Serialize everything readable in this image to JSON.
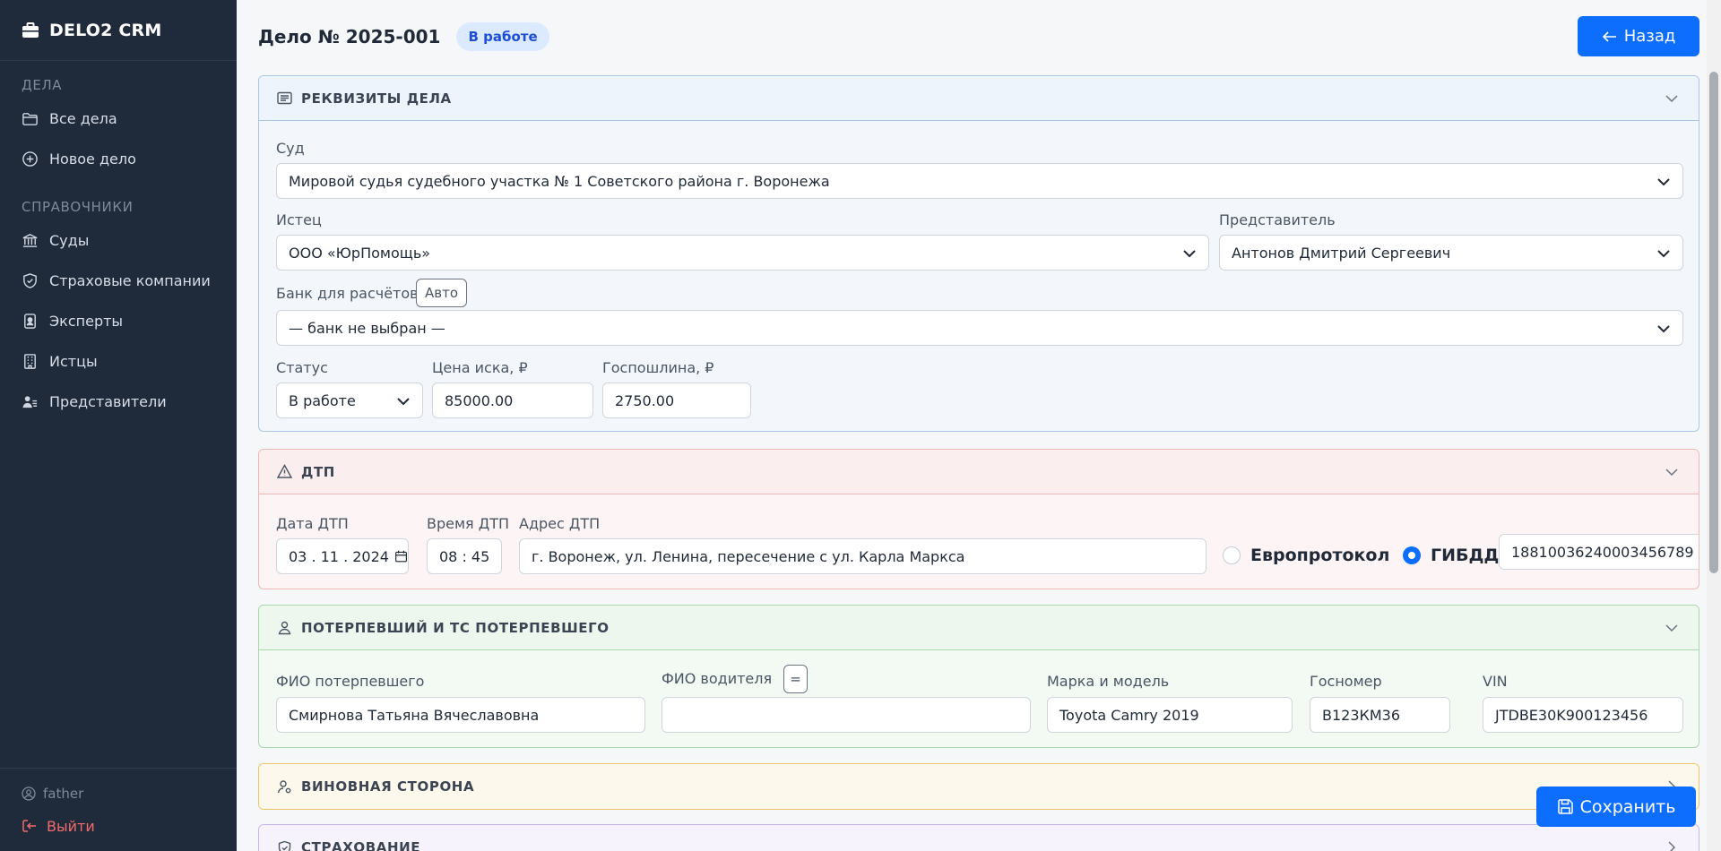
{
  "brand": {
    "name": "DELO2 CRM"
  },
  "sidebar": {
    "sections": [
      {
        "title": "ДЕЛА",
        "items": [
          {
            "label": "Все дела",
            "icon": "folder-icon"
          },
          {
            "label": "Новое дело",
            "icon": "plus-circle-icon"
          }
        ]
      },
      {
        "title": "СПРАВОЧНИКИ",
        "items": [
          {
            "label": "Суды",
            "icon": "bank-icon"
          },
          {
            "label": "Страховые компании",
            "icon": "shield-icon"
          },
          {
            "label": "Эксперты",
            "icon": "badge-icon"
          },
          {
            "label": "Истцы",
            "icon": "building-icon"
          },
          {
            "label": "Представители",
            "icon": "people-icon"
          }
        ]
      }
    ],
    "user": "father",
    "logout": "Выйти"
  },
  "header": {
    "title": "Дело № 2025-001",
    "status_badge": "В работе",
    "back_button": "Назад"
  },
  "rekv": {
    "title": "РЕКВИЗИТЫ ДЕЛА",
    "court_label": "Суд",
    "court_value": "Мировой судья судебного участка № 1 Советского района г. Воронежа",
    "plaintiff_label": "Истец",
    "plaintiff_value": "ООО «ЮрПомощь»",
    "rep_label": "Представитель",
    "rep_value": "Антонов Дмитрий Сергеевич",
    "bank_label": "Банк для расчётов",
    "bank_auto": "Авто",
    "bank_value": "— банк не выбран —",
    "status_label": "Статус",
    "status_value": "В работе",
    "price_label": "Цена иска, ₽",
    "price_value": "85000.00",
    "fee_label": "Госпошлина, ₽",
    "fee_value": "2750.00"
  },
  "dtp": {
    "title": "ДТП",
    "date_label": "Дата ДТП",
    "date_value": "03 . 11 . 2024",
    "time_label": "Время ДТП",
    "time_value": "08 : 45",
    "address_label": "Адрес ДТП",
    "address_value": "г. Воронеж, ул. Ленина, пересечение с ул. Карла Маркса",
    "radio_euro": "Европротокол",
    "radio_gibdd": "ГИБДД",
    "radio_selected": "ГИБДД",
    "gibdd_number": "18810036240003456789"
  },
  "pot": {
    "title": "ПОТЕРПЕВШИЙ И ТС ПОТЕРПЕВШЕГО",
    "victim_label": "ФИО потерпевшего",
    "victim_value": "Смирнова Татьяна Вячеславовна",
    "driver_label": "ФИО водителя",
    "driver_copy": "=",
    "driver_value": "",
    "car_label": "Марка и модель",
    "car_value": "Toyota Camry 2019",
    "plate_label": "Госномер",
    "plate_value": "В123КМ36",
    "vin_label": "VIN",
    "vin_value": "JTDBE30K900123456"
  },
  "vin_section": {
    "title": "ВИНОВНАЯ СТОРОНА"
  },
  "str_section": {
    "title": "СТРАХОВАНИЕ"
  },
  "save_button": "Сохранить",
  "colors": {
    "primary": "#0d6efd",
    "sidebar_bg": "#1f2a3a",
    "danger": "#f26b6b"
  }
}
